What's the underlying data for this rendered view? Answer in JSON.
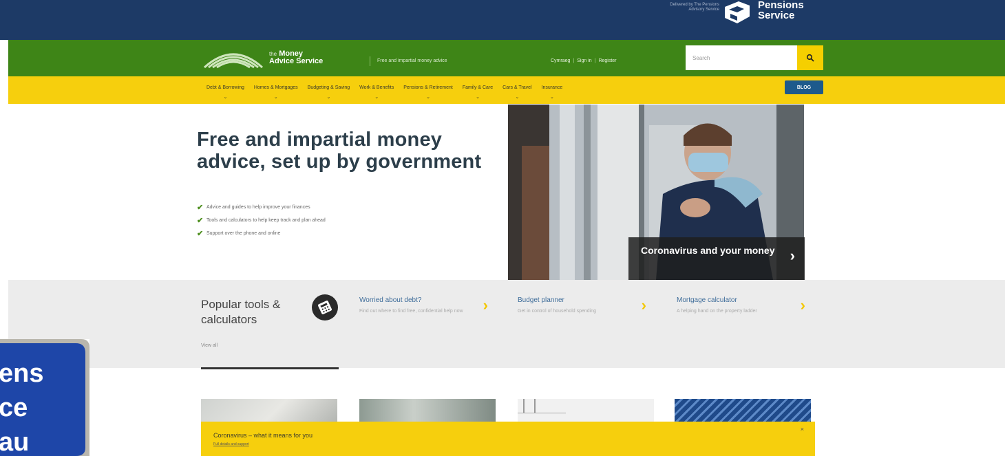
{
  "header": {
    "pensions_small_text": "Delivered by The Pensions Advisory Service",
    "pensions_title_line1": "Pensions",
    "pensions_title_line2": "Service"
  },
  "brand": {
    "logo_prefix": "the",
    "logo_line1": "Money",
    "logo_line2": "Advice Service",
    "tagline": "Free and impartial money advice"
  },
  "account": {
    "language": "Cymraeg",
    "sign_in": "Sign in",
    "register": "Register"
  },
  "search": {
    "placeholder": "Search"
  },
  "nav": {
    "items": [
      "Debt & Borrowing",
      "Homes & Mortgages",
      "Budgeting & Saving",
      "Work & Benefits",
      "Pensions & Retirement",
      "Family & Care",
      "Cars & Travel",
      "Insurance"
    ],
    "blog": "BLOG"
  },
  "hero": {
    "title": "Free and impartial money advice, set up by government",
    "points": [
      "Advice and guides to help improve your finances",
      "Tools and calculators to help keep track and plan ahead",
      "Support over the phone and online"
    ],
    "caption": "Coronavirus and your money"
  },
  "tools": {
    "title": "Popular tools & calculators",
    "view_all": "View all",
    "items": [
      {
        "title": "Worried about debt?",
        "desc": "Find out where to find free, confidential help now"
      },
      {
        "title": "Budget planner",
        "desc": "Get in control of household spending"
      },
      {
        "title": "Mortgage calculator",
        "desc": "A helping hand on the property ladder"
      }
    ]
  },
  "banner": {
    "title": "Coronavirus – what it means for you",
    "subtitle": "Full details and support",
    "close": "×"
  },
  "sign": {
    "line1": "ens",
    "line2": "ce",
    "line3": "au"
  },
  "colors": {
    "navy": "#1d3a66",
    "green": "#3e8517",
    "yellow": "#f6cf0d",
    "blog_blue": "#1d5a8c"
  }
}
